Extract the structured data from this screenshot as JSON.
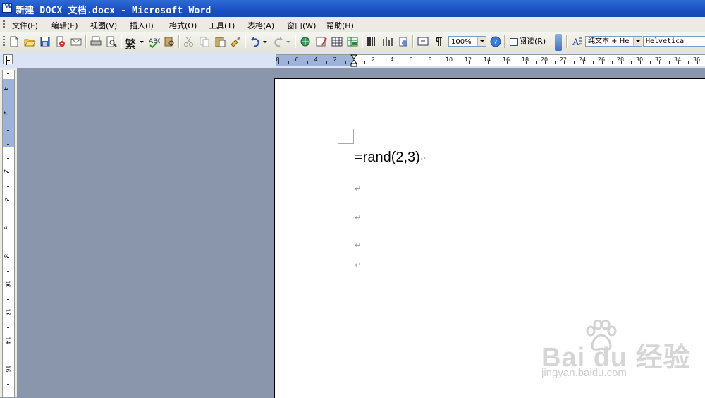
{
  "window": {
    "title": "新建 DOCX 文档.docx - Microsoft Word"
  },
  "menubar": {
    "items": [
      "文件(F)",
      "编辑(E)",
      "视图(V)",
      "插入(I)",
      "格式(O)",
      "工具(T)",
      "表格(A)",
      "窗口(W)",
      "帮助(H)"
    ]
  },
  "toolbar": {
    "traditional_label": "繁",
    "zoom_value": "100%",
    "read_label": "阅读(R)",
    "style_value": "纯文本 + He",
    "font_value": "Helvetica",
    "style_icon_label": "A"
  },
  "ruler": {
    "h_numbers": [
      "8",
      "6",
      "4",
      "2",
      "2",
      "4",
      "6",
      "8",
      "10",
      "12",
      "14",
      "16",
      "18",
      "20",
      "22",
      "24",
      "26",
      "28",
      "30",
      "32",
      "34",
      "36"
    ],
    "v_numbers": [
      "4",
      "2",
      "2",
      "4",
      "6",
      "8",
      "10",
      "12",
      "14",
      "16"
    ]
  },
  "document": {
    "line1": "=rand(2,3)",
    "paragraph_mark": "↵"
  },
  "watermark": {
    "logo": "Bai du 经验",
    "sub": "jingyan.baidu.com"
  }
}
